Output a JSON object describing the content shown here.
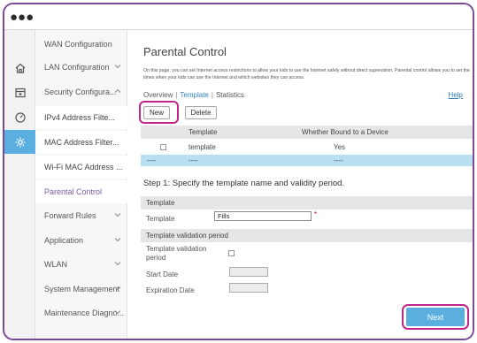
{
  "colors": {
    "accent": "#5aaee0",
    "highlight": "#c2268a",
    "frame": "#7a4a96",
    "link": "#2f7fbf"
  },
  "iconbar": [
    {
      "name": "home-icon"
    },
    {
      "name": "network-icon"
    },
    {
      "name": "gauge-icon"
    },
    {
      "name": "gear-icon",
      "active": true
    }
  ],
  "sidebar": {
    "items": [
      {
        "label": "WAN Configuration"
      },
      {
        "label": "LAN Configuration"
      },
      {
        "label": "Security Configura..."
      },
      {
        "label": "IPv4 Address Filte..."
      },
      {
        "label": "MAC Address Filter..."
      },
      {
        "label": "Wi-Fi MAC Address ..."
      },
      {
        "label": "Parental Control"
      },
      {
        "label": "Forward Rules"
      },
      {
        "label": "Application"
      },
      {
        "label": "WLAN"
      },
      {
        "label": "System Management"
      },
      {
        "label": "Maintenance Diagno..."
      }
    ]
  },
  "main": {
    "title": "Parental Control",
    "description": "On this page, you can set Internet access restrictions to allow your kids to use the Internet safely without direct supervision. Parental control allows you to set the times when your kids can use the Internet and which websites they can access.",
    "tabs": [
      "Overview",
      "Template",
      "Statistics"
    ],
    "tab_separator": "|",
    "help": "Help",
    "buttons": {
      "new": "New",
      "delete": "Delete",
      "next": "Next"
    },
    "table": {
      "headers": [
        "Template",
        "Whether Bound to a Device"
      ],
      "rows": [
        {
          "template": "template",
          "bound": "Yes"
        },
        {
          "col0": "----",
          "template": "----",
          "bound": "----"
        }
      ]
    },
    "step_title": "Step 1: Specify the template name and validity period.",
    "section_template": "Template",
    "template_label": "Template",
    "template_value": "Fills",
    "required_mark": "*",
    "section_validity": "Template validation period",
    "validity_label": "Template validation period",
    "start_label": "Start Date",
    "expiration_label": "Expiration Date"
  }
}
